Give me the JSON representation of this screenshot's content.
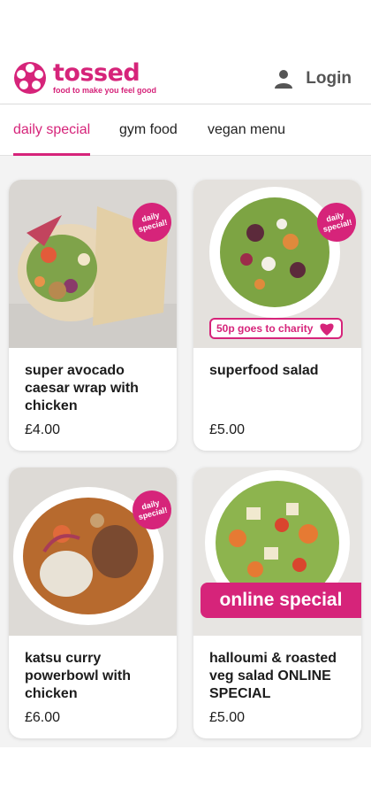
{
  "brand": {
    "name": "tossed",
    "tagline": "food to make you feel good",
    "color": "#d6247a"
  },
  "header": {
    "login_label": "Login",
    "login_icon": "user-icon"
  },
  "tabs": [
    {
      "label": "daily special",
      "active": true
    },
    {
      "label": "gym food",
      "active": false
    },
    {
      "label": "vegan menu",
      "active": false
    }
  ],
  "products": [
    {
      "title": "super avocado caesar wrap with chicken",
      "price": "£4.00",
      "badge": "daily special!"
    },
    {
      "title": "superfood salad",
      "price": "£5.00",
      "badge": "daily special!",
      "charity": "50p goes to charity"
    },
    {
      "title": "katsu curry powerbowl with chicken",
      "price": "£6.00",
      "badge": "daily special!"
    },
    {
      "title": "halloumi & roasted veg salad ONLINE SPECIAL",
      "price": "£5.00",
      "banner": "online special"
    }
  ]
}
